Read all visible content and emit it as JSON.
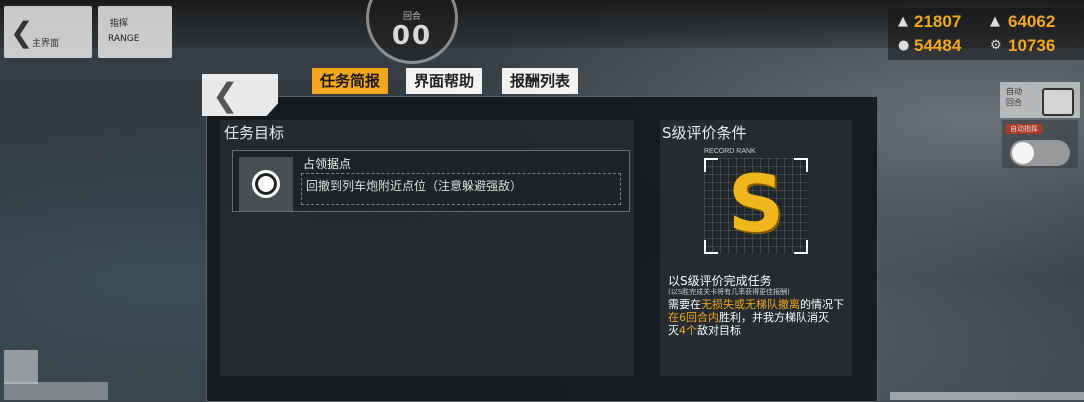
{
  "topbar": {
    "back_label": "主界面",
    "home_label_1": "指挥",
    "home_label_2": "RANGE",
    "turn_label": "回合",
    "turn_value": "00"
  },
  "resources": [
    {
      "icon": "manpower-icon",
      "value": "21807"
    },
    {
      "icon": "ammo-icon",
      "value": "64062"
    },
    {
      "icon": "ration-icon",
      "value": "54484"
    },
    {
      "icon": "parts-icon",
      "value": "10736"
    }
  ],
  "side": {
    "button_label": "自动\n回合",
    "toggle_header": "自动指挥",
    "colors": {
      "accent": "#f2a61c",
      "rank": "#f0b61c"
    }
  },
  "tabs": [
    {
      "label": "任务简报",
      "active": true
    },
    {
      "label": "界面帮助",
      "active": false
    },
    {
      "label": "报酬列表",
      "active": false
    }
  ],
  "objectives": {
    "title": "任务目标",
    "items": [
      {
        "name": "占领据点",
        "desc": "回撤到列车炮附近点位（注意躲避强敌）",
        "icon": "circle-marker-icon"
      }
    ]
  },
  "rank": {
    "title": "S级评价条件",
    "caption": "RECORD RANK",
    "letter": "S",
    "condition": "以S级评价完成任务",
    "note": "(以S胜完成关卡将有几率获得更佳报酬)",
    "line1_pre": "需要在",
    "line1_hl": "无损失或无梯队撤离",
    "line1_post": "的情况下",
    "line2_hl": "在6回合内",
    "line2_post": "胜利，并我方梯队消灭",
    "line3_hl": "4个",
    "line3_post": "敌对目标"
  }
}
